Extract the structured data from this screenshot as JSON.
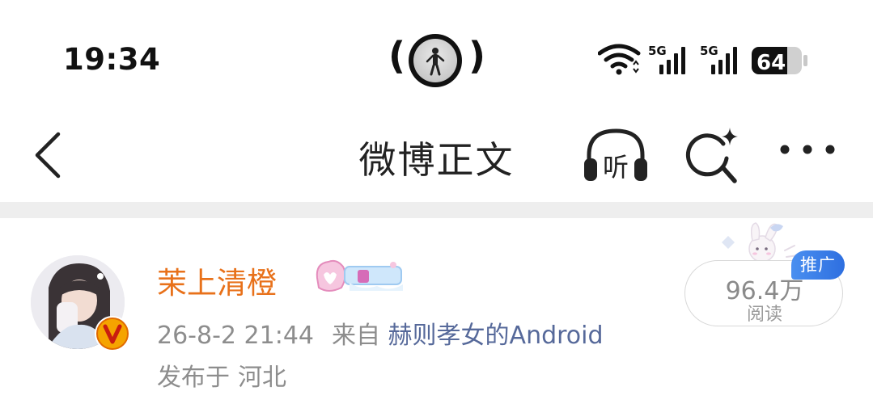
{
  "status_bar": {
    "time": "19:34",
    "network_1": "5G",
    "network_2": "5G",
    "battery": "64"
  },
  "nav": {
    "title": "微博正文",
    "listen_label": "听",
    "icons": [
      "back-arrow-icon",
      "headphones-icon",
      "ai-search-icon",
      "more-icon"
    ]
  },
  "post": {
    "username": "茉上清橙",
    "datetime": "26-8-2 21:44",
    "source_prefix": "来自",
    "source": "赫则孝女的Android",
    "location_prefix": "发布于",
    "location": "河北",
    "read_count": "96.4万",
    "read_label": "阅读",
    "promo_badge": "推广"
  },
  "colors": {
    "username": "#e8711a",
    "source_link": "#56699a",
    "meta_gray": "#8d8d8d",
    "vip_badge": "#f5a400",
    "promo_blue": "#2e6fe0",
    "divider": "#eeeeee"
  }
}
